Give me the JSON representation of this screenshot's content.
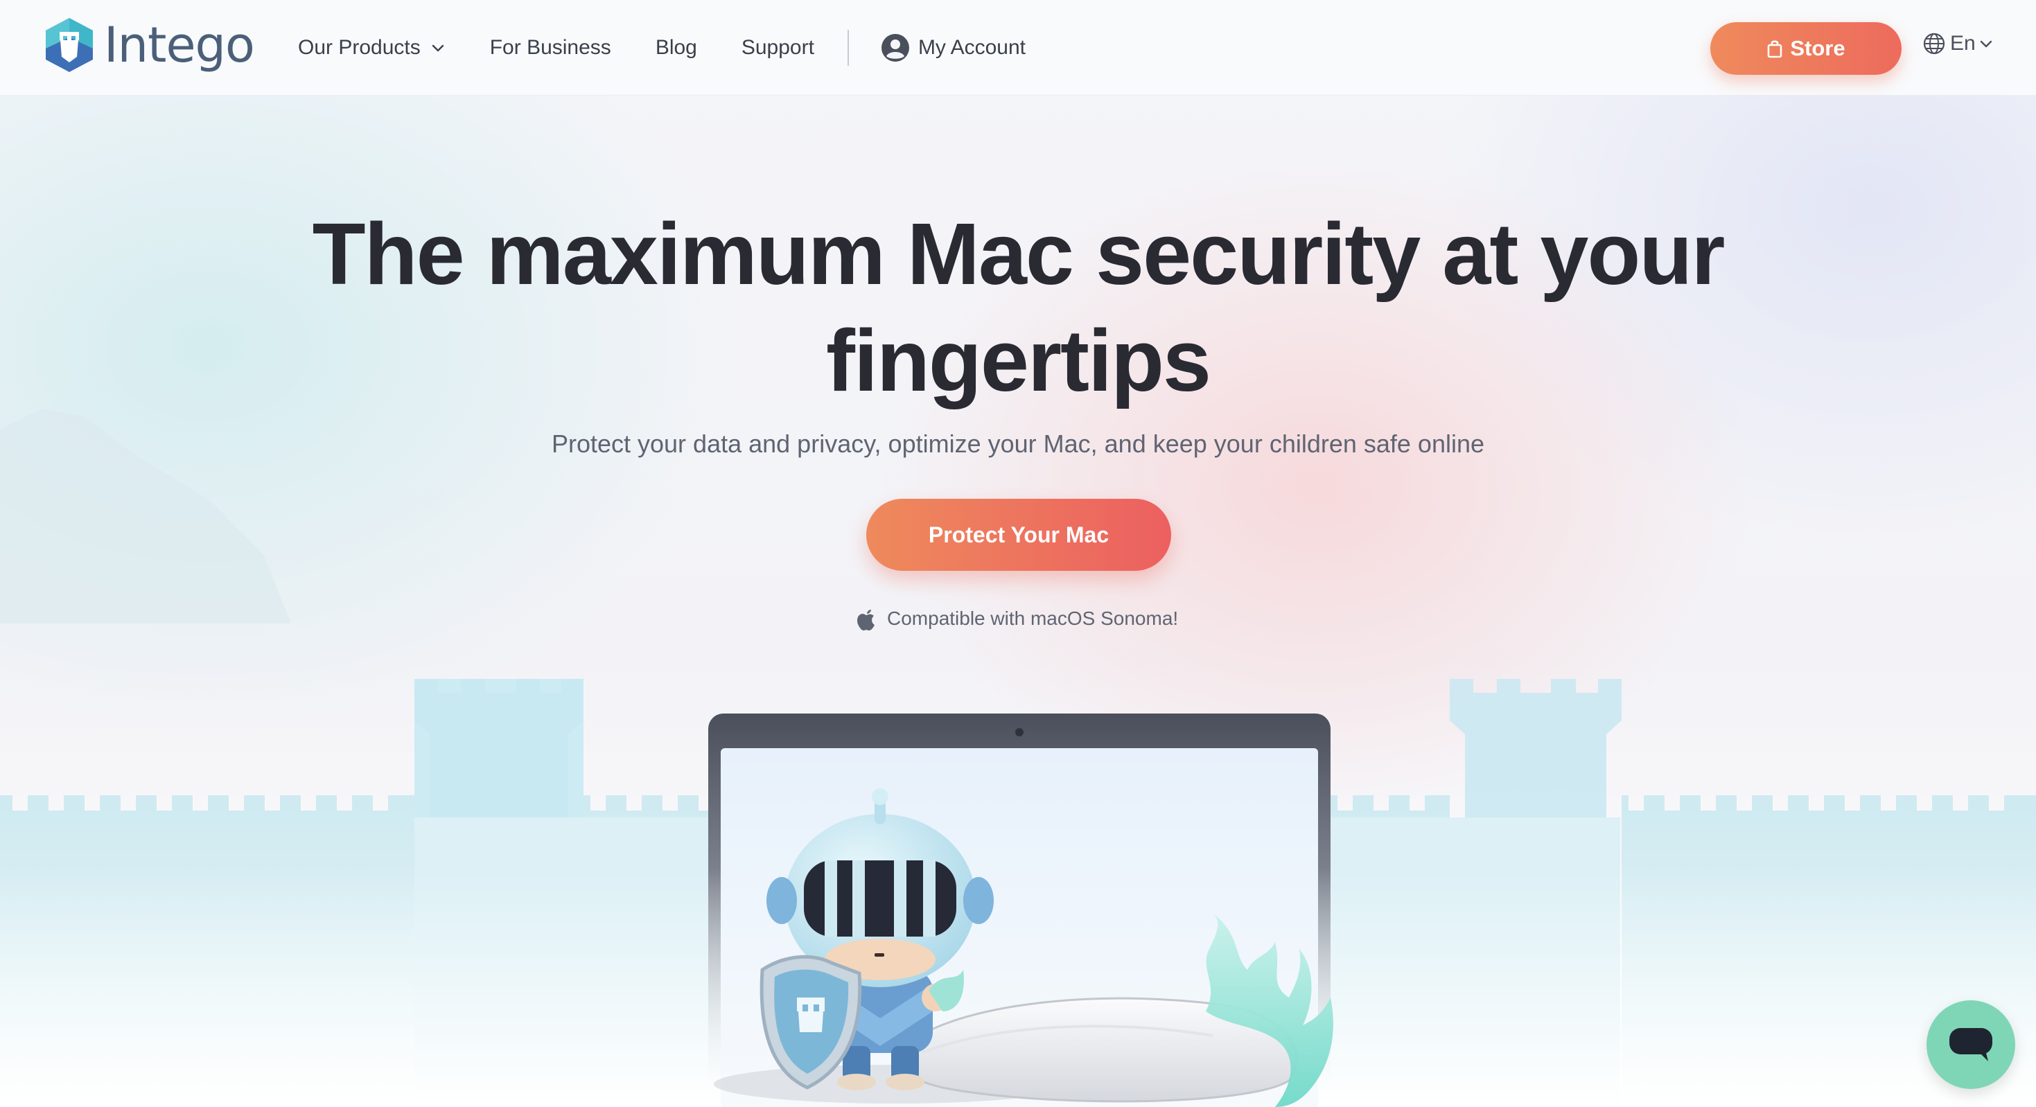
{
  "header": {
    "logo_text": "Intego",
    "nav": {
      "products": "Our Products",
      "business": "For Business",
      "blog": "Blog",
      "support": "Support",
      "account": "My Account"
    },
    "store_label": "Store",
    "language": "En"
  },
  "hero": {
    "headline": "The maximum Mac security at your fingertips",
    "subhead": "Protect your data and privacy, optimize your Mac, and keep your children safe online",
    "cta_label": "Protect Your Mac",
    "compat_text": "Compatible with macOS Sonoma!"
  },
  "colors": {
    "accent": "#ED6B5D",
    "accent_start": "#EF8A5C",
    "logo_teal": "#3FB7C9",
    "logo_blue": "#3D6FB6",
    "headline": "#2A2A33",
    "chat": "#7FD6B6"
  },
  "icons": {
    "logo": "intego-shield-logo-icon",
    "products_chevron": "chevron-down-icon",
    "account": "user-circle-icon",
    "store": "shopping-bag-icon",
    "language": "globe-icon",
    "compat": "apple-icon",
    "chat": "chat-bubble-icon"
  }
}
